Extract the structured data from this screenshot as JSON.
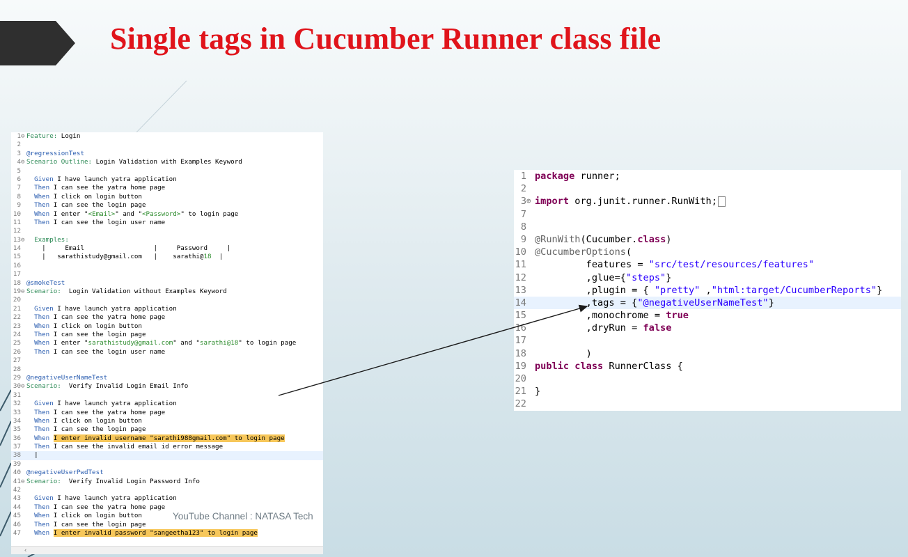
{
  "slide": {
    "title": "Single tags in Cucumber Runner class file",
    "watermark": "YouTube Channel : NATASA Tech"
  },
  "feature_editor": {
    "lines": [
      {
        "n": "1",
        "fold": "⊖",
        "parts": [
          {
            "t": "Feature:",
            "c": "kw-green"
          },
          {
            "t": " Login",
            "c": ""
          }
        ]
      },
      {
        "n": "2",
        "fold": "",
        "parts": []
      },
      {
        "n": "3",
        "fold": "",
        "parts": [
          {
            "t": "@regressionTest",
            "c": "tag-blue"
          }
        ]
      },
      {
        "n": "4",
        "fold": "⊖",
        "parts": [
          {
            "t": "Scenario Outline:",
            "c": "kw-green"
          },
          {
            "t": " Login Validation with Examples Keyword",
            "c": ""
          }
        ]
      },
      {
        "n": "5",
        "fold": "",
        "parts": []
      },
      {
        "n": "6",
        "fold": "",
        "parts": [
          {
            "t": "  Given",
            "c": "kw-blue"
          },
          {
            "t": " I have launch yatra application",
            "c": ""
          }
        ]
      },
      {
        "n": "7",
        "fold": "",
        "parts": [
          {
            "t": "  Then",
            "c": "kw-blue"
          },
          {
            "t": " I can see the yatra home page",
            "c": ""
          }
        ]
      },
      {
        "n": "8",
        "fold": "",
        "parts": [
          {
            "t": "  When",
            "c": "kw-blue"
          },
          {
            "t": " I click on login button",
            "c": ""
          }
        ]
      },
      {
        "n": "9",
        "fold": "",
        "parts": [
          {
            "t": "  Then",
            "c": "kw-blue"
          },
          {
            "t": " I can see the login page",
            "c": ""
          }
        ]
      },
      {
        "n": "10",
        "fold": "",
        "parts": [
          {
            "t": "  When",
            "c": "kw-blue"
          },
          {
            "t": " I enter \"",
            "c": ""
          },
          {
            "t": "<Email>",
            "c": "str-green"
          },
          {
            "t": "\" and \"",
            "c": ""
          },
          {
            "t": "<Password>",
            "c": "str-green"
          },
          {
            "t": "\" to login page",
            "c": ""
          }
        ]
      },
      {
        "n": "11",
        "fold": "",
        "parts": [
          {
            "t": "  Then",
            "c": "kw-blue"
          },
          {
            "t": " I can see the login user name",
            "c": ""
          }
        ]
      },
      {
        "n": "12",
        "fold": "",
        "parts": []
      },
      {
        "n": "13",
        "fold": "⊖",
        "parts": [
          {
            "t": "  Examples:",
            "c": "kw-green"
          }
        ]
      },
      {
        "n": "14",
        "fold": "",
        "parts": [
          {
            "t": "    |     Email                  |     Password     |",
            "c": ""
          }
        ]
      },
      {
        "n": "15",
        "fold": "",
        "parts": [
          {
            "t": "    |   sarathistudy@gmail.com   |    sarathi@",
            "c": ""
          },
          {
            "t": "18",
            "c": "str-green"
          },
          {
            "t": "  |",
            "c": ""
          }
        ]
      },
      {
        "n": "16",
        "fold": "",
        "parts": []
      },
      {
        "n": "17",
        "fold": "",
        "parts": []
      },
      {
        "n": "18",
        "fold": "",
        "parts": [
          {
            "t": "@smokeTest",
            "c": "tag-blue"
          }
        ]
      },
      {
        "n": "19",
        "fold": "⊖",
        "parts": [
          {
            "t": "Scenario:",
            "c": "kw-green"
          },
          {
            "t": "  Login Validation without Examples Keyword",
            "c": ""
          }
        ]
      },
      {
        "n": "20",
        "fold": "",
        "parts": []
      },
      {
        "n": "21",
        "fold": "",
        "parts": [
          {
            "t": "  Given",
            "c": "kw-blue"
          },
          {
            "t": " I have launch yatra application",
            "c": ""
          }
        ]
      },
      {
        "n": "22",
        "fold": "",
        "parts": [
          {
            "t": "  Then",
            "c": "kw-blue"
          },
          {
            "t": " I can see the yatra home page",
            "c": ""
          }
        ]
      },
      {
        "n": "23",
        "fold": "",
        "parts": [
          {
            "t": "  When",
            "c": "kw-blue"
          },
          {
            "t": " I click on login button",
            "c": ""
          }
        ]
      },
      {
        "n": "24",
        "fold": "",
        "parts": [
          {
            "t": "  Then",
            "c": "kw-blue"
          },
          {
            "t": " I can see the login page",
            "c": ""
          }
        ]
      },
      {
        "n": "25",
        "fold": "",
        "parts": [
          {
            "t": "  When",
            "c": "kw-blue"
          },
          {
            "t": " I enter \"",
            "c": ""
          },
          {
            "t": "sarathistudy@gmail.com",
            "c": "str-green"
          },
          {
            "t": "\" and \"",
            "c": ""
          },
          {
            "t": "sarathi@18",
            "c": "str-green"
          },
          {
            "t": "\" to login page",
            "c": ""
          }
        ]
      },
      {
        "n": "26",
        "fold": "",
        "parts": [
          {
            "t": "  Then",
            "c": "kw-blue"
          },
          {
            "t": " I can see the login user name",
            "c": ""
          }
        ]
      },
      {
        "n": "27",
        "fold": "",
        "parts": []
      },
      {
        "n": "28",
        "fold": "",
        "parts": []
      },
      {
        "n": "29",
        "fold": "",
        "parts": [
          {
            "t": "@negativeUserNameTest",
            "c": "tag-blue"
          }
        ]
      },
      {
        "n": "30",
        "fold": "⊖",
        "parts": [
          {
            "t": "Scenario:",
            "c": "kw-green"
          },
          {
            "t": "  Verify Invalid Login Email Info",
            "c": ""
          }
        ]
      },
      {
        "n": "31",
        "fold": "",
        "parts": []
      },
      {
        "n": "32",
        "fold": "",
        "parts": [
          {
            "t": "  Given",
            "c": "kw-blue"
          },
          {
            "t": " I have launch yatra application",
            "c": ""
          }
        ]
      },
      {
        "n": "33",
        "fold": "",
        "parts": [
          {
            "t": "  Then",
            "c": "kw-blue"
          },
          {
            "t": " I can see the yatra home page",
            "c": ""
          }
        ]
      },
      {
        "n": "34",
        "fold": "",
        "parts": [
          {
            "t": "  When",
            "c": "kw-blue"
          },
          {
            "t": " I click on login button",
            "c": ""
          }
        ]
      },
      {
        "n": "35",
        "fold": "",
        "parts": [
          {
            "t": "  Then",
            "c": "kw-blue"
          },
          {
            "t": " I can see the login page",
            "c": ""
          }
        ]
      },
      {
        "n": "36",
        "fold": "",
        "parts": [
          {
            "t": "  When",
            "c": "kw-blue"
          },
          {
            "t": " ",
            "c": ""
          },
          {
            "t": "I enter invalid username \"sarathi988gmail.com\" to login page",
            "c": "hl-yellow"
          }
        ]
      },
      {
        "n": "37",
        "fold": "",
        "parts": [
          {
            "t": "  Then",
            "c": "kw-blue"
          },
          {
            "t": " I can see the invalid email id error message",
            "c": ""
          }
        ]
      },
      {
        "n": "38",
        "fold": "",
        "parts": [
          {
            "t": "  |",
            "c": ""
          }
        ],
        "current": true
      },
      {
        "n": "39",
        "fold": "",
        "parts": []
      },
      {
        "n": "40",
        "fold": "",
        "parts": [
          {
            "t": "@negativeUserPwdTest",
            "c": "tag-blue"
          }
        ]
      },
      {
        "n": "41",
        "fold": "⊖",
        "parts": [
          {
            "t": "Scenario:",
            "c": "kw-green"
          },
          {
            "t": "  Verify Invalid Login Password Info",
            "c": ""
          }
        ]
      },
      {
        "n": "42",
        "fold": "",
        "parts": []
      },
      {
        "n": "43",
        "fold": "",
        "parts": [
          {
            "t": "  Given",
            "c": "kw-blue"
          },
          {
            "t": " I have launch yatra application",
            "c": ""
          }
        ]
      },
      {
        "n": "44",
        "fold": "",
        "parts": [
          {
            "t": "  Then",
            "c": "kw-blue"
          },
          {
            "t": " I can see the yatra home page",
            "c": ""
          }
        ]
      },
      {
        "n": "45",
        "fold": "",
        "parts": [
          {
            "t": "  When",
            "c": "kw-blue"
          },
          {
            "t": " I click on login button",
            "c": ""
          }
        ]
      },
      {
        "n": "46",
        "fold": "",
        "parts": [
          {
            "t": "  Then",
            "c": "kw-blue"
          },
          {
            "t": " I can see the login page",
            "c": ""
          }
        ]
      },
      {
        "n": "47",
        "fold": "",
        "parts": [
          {
            "t": "  When",
            "c": "kw-blue"
          },
          {
            "t": " ",
            "c": ""
          },
          {
            "t": "I enter invalid password \"sangeetha123\" to login page",
            "c": "hl-yellow"
          }
        ]
      }
    ],
    "scroll_glyph": "‹"
  },
  "runner_editor": {
    "lines": [
      {
        "n": "1",
        "fold": "",
        "parts": [
          {
            "t": "package",
            "c": "rk"
          },
          {
            "t": " runner;",
            "c": ""
          }
        ]
      },
      {
        "n": "2",
        "fold": "",
        "parts": []
      },
      {
        "n": "3",
        "fold": "⊕",
        "parts": [
          {
            "t": "import",
            "c": "rk"
          },
          {
            "t": " org.junit.runner.RunWith;",
            "c": ""
          }
        ],
        "collapsed": true
      },
      {
        "n": "7",
        "fold": "",
        "parts": []
      },
      {
        "n": "8",
        "fold": "",
        "parts": []
      },
      {
        "n": "9",
        "fold": "",
        "parts": [
          {
            "t": "@RunWith",
            "c": "ra"
          },
          {
            "t": "(Cucumber.",
            "c": ""
          },
          {
            "t": "class",
            "c": "rk"
          },
          {
            "t": ")",
            "c": ""
          }
        ]
      },
      {
        "n": "10",
        "fold": "",
        "parts": [
          {
            "t": "@CucumberOptions",
            "c": "ra"
          },
          {
            "t": "(",
            "c": ""
          }
        ]
      },
      {
        "n": "11",
        "fold": "",
        "parts": [
          {
            "t": "         features = ",
            "c": ""
          },
          {
            "t": "\"src/test/resources/features\"",
            "c": "rs"
          }
        ]
      },
      {
        "n": "12",
        "fold": "",
        "parts": [
          {
            "t": "         ,glue={",
            "c": ""
          },
          {
            "t": "\"steps\"",
            "c": "rs"
          },
          {
            "t": "}",
            "c": ""
          }
        ]
      },
      {
        "n": "13",
        "fold": "",
        "parts": [
          {
            "t": "         ,plugin = { ",
            "c": ""
          },
          {
            "t": "\"pretty\"",
            "c": "rs"
          },
          {
            "t": " ,",
            "c": ""
          },
          {
            "t": "\"html:target/CucumberReports\"",
            "c": "rs"
          },
          {
            "t": "}",
            "c": ""
          }
        ]
      },
      {
        "n": "14",
        "fold": "",
        "parts": [
          {
            "t": "         ,tags = {",
            "c": ""
          },
          {
            "t": "\"@negativeUserNameTest\"",
            "c": "rs"
          },
          {
            "t": "}",
            "c": ""
          }
        ],
        "current": true
      },
      {
        "n": "15",
        "fold": "",
        "parts": [
          {
            "t": "         ,monochrome = ",
            "c": ""
          },
          {
            "t": "true",
            "c": "rk"
          }
        ]
      },
      {
        "n": "16",
        "fold": "",
        "parts": [
          {
            "t": "         ,dryRun = ",
            "c": ""
          },
          {
            "t": "false",
            "c": "rk"
          }
        ]
      },
      {
        "n": "17",
        "fold": "",
        "parts": []
      },
      {
        "n": "18",
        "fold": "",
        "parts": [
          {
            "t": "         )",
            "c": ""
          }
        ]
      },
      {
        "n": "19",
        "fold": "",
        "parts": [
          {
            "t": "public",
            "c": "rk"
          },
          {
            "t": " ",
            "c": ""
          },
          {
            "t": "class",
            "c": "rk"
          },
          {
            "t": " RunnerClass {",
            "c": ""
          }
        ]
      },
      {
        "n": "20",
        "fold": "",
        "parts": []
      },
      {
        "n": "21",
        "fold": "",
        "parts": [
          {
            "t": "}",
            "c": ""
          }
        ]
      },
      {
        "n": "22",
        "fold": "",
        "parts": []
      }
    ]
  },
  "colors": {
    "title_red": "#e0141b",
    "banner_dark": "#2f2f2f",
    "highlight_yellow": "#f7c75a",
    "current_line": "#e8f2fe"
  }
}
